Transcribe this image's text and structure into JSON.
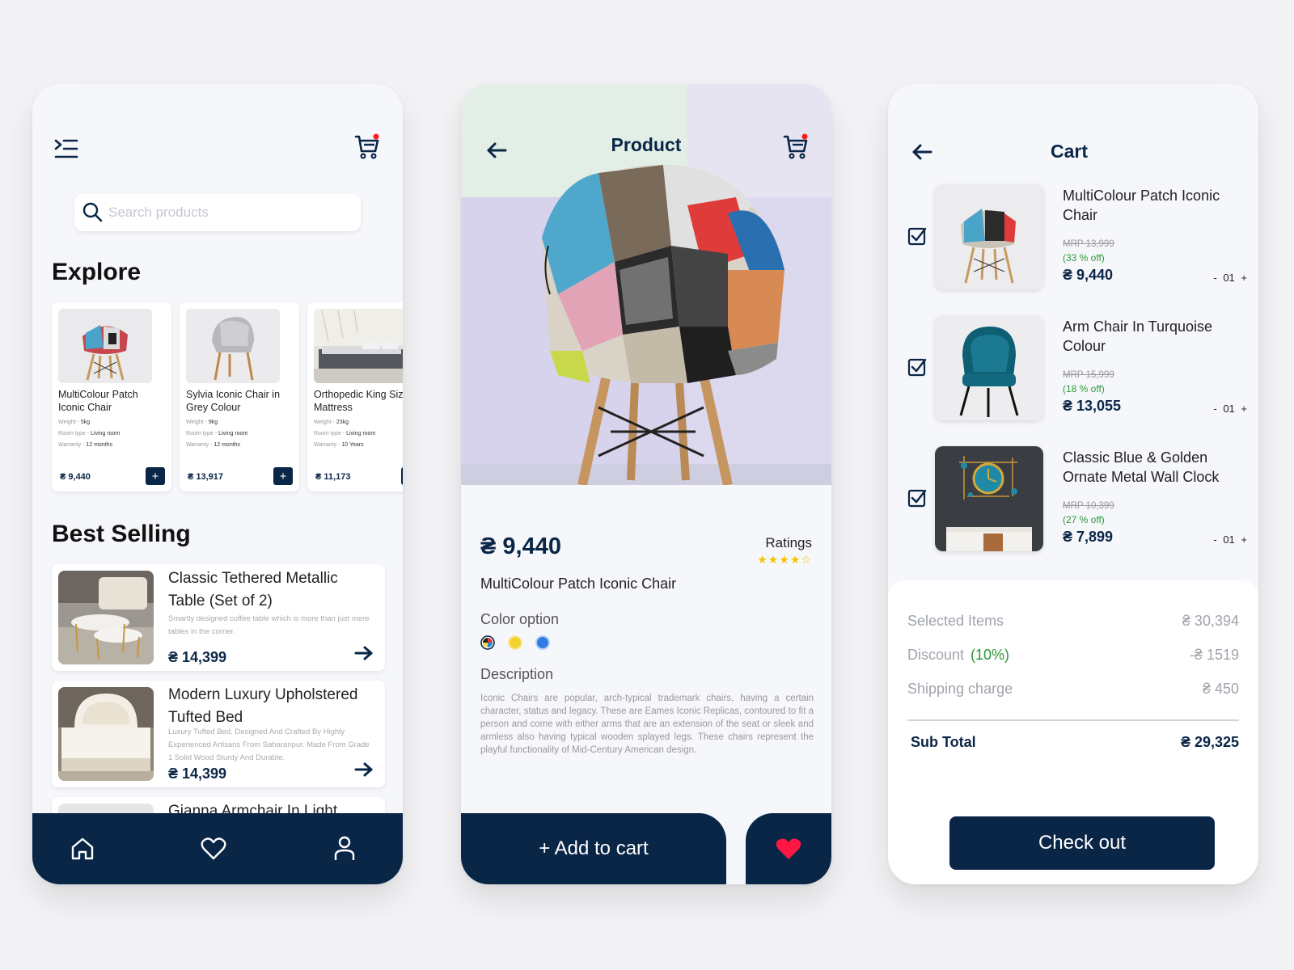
{
  "home": {
    "search_placeholder": "Search products",
    "explore_title": "Explore",
    "explore": [
      {
        "name": "MultiColour Patch Iconic Chair",
        "weight_label": "Weight - ",
        "weight": "5kg",
        "room_label": "Room type - ",
        "room": "Living room",
        "warranty_label": "Warranty - ",
        "warranty": "12 months",
        "price": "₴ 9,440"
      },
      {
        "name": "Sylvia Iconic Chair in Grey Colour",
        "weight_label": "Weight - ",
        "weight": "9kg",
        "room_label": "Room type - ",
        "room": "Living room",
        "warranty_label": "Warranty - ",
        "warranty": "12 months",
        "price": "₴ 13,917"
      },
      {
        "name": "Orthopedic King Size Mattress",
        "weight_label": "Weight - ",
        "weight": "23kg",
        "room_label": "Room type - ",
        "room": "Living room",
        "warranty_label": "Warranty - ",
        "warranty": "10 Years",
        "price": "₴ 11,173"
      }
    ],
    "best_title": "Best Selling",
    "best": [
      {
        "title": "Classic Tethered Metallic Table (Set of 2)",
        "desc": "Smartly designed coffee table which is more than just mere tables in the corner.",
        "price": "₴ 14,399"
      },
      {
        "title": "Modern Luxury Upholstered Tufted Bed",
        "desc": "Luxury Tufted Bed. Designed And Crafted By Highly Experienced Artisans From Saharanpur. Made From Grade 1 Solid Wood Sturdy And Durable.",
        "price": "₴ 14,399"
      },
      {
        "title": "Gianna Armchair In Light"
      }
    ],
    "plus": "+"
  },
  "product": {
    "title": "Product",
    "price": "₴ 9,440",
    "ratings_label": "Ratings",
    "stars": "★★★★☆",
    "rating": 4,
    "name": "MultiColour Patch Iconic Chair",
    "color_label": "Color option",
    "colors": [
      "#f2d230",
      "#2f7de1"
    ],
    "description_label": "Description",
    "description": "Iconic Chairs are popular, arch-typical trademark chairs, having a certain character, status and legacy. These are Eames Iconic Replicas, contoured to fit a person and come with either arms that are an extension of the seat or sleek and armless also having typical wooden splayed legs. These chairs represent the playful functionality of Mid-Century American design.",
    "add_to_cart": "+ Add to cart"
  },
  "cart": {
    "title": "Cart",
    "items": [
      {
        "name": "MultiColour Patch Iconic Chair",
        "mrp": "MRP 13,999",
        "off": "(33 % off)",
        "price": "₴ 9,440",
        "qty": "- 01 +"
      },
      {
        "name": "Arm Chair In Turquoise Colour",
        "mrp": "MRP 15,999",
        "off": "(18 % off)",
        "price": "₴ 13,055",
        "qty": "- 01 +"
      },
      {
        "name": "Classic Blue & Golden Ornate Metal Wall Clock",
        "mrp": "MRP 10,399",
        "off": "(27 % off)",
        "price": "₴ 7,899",
        "qty": "- 01 +"
      }
    ],
    "selected_label": "Selected Items",
    "selected_value": "₴ 30,394",
    "discount_label": "Discount",
    "discount_pct": "(10%)",
    "discount_value": "-₴ 1519",
    "shipping_label": "Shipping charge",
    "shipping_value": "₴ 450",
    "subtotal_label": "Sub Total",
    "subtotal_value": "₴ 29,325",
    "checkout": "Check out"
  },
  "colors": {
    "navy": "#0a2647",
    "green": "#2a9a3a",
    "star": "#f2c400",
    "heart": "#ff1744",
    "badge": "#ff1a1a"
  }
}
